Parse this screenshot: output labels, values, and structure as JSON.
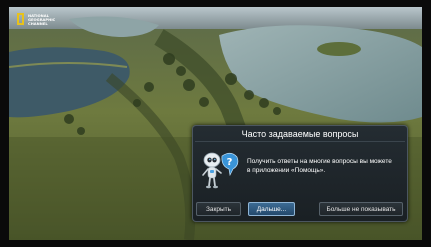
{
  "channel_logo": {
    "lines": [
      "NATIONAL",
      "GEOGRAPHIC",
      "CHANNEL"
    ],
    "frame_color": "#e8c21b"
  },
  "dialog": {
    "title": "Часто задаваемые вопросы",
    "message_line1": "Получить ответы на многие вопросы вы можете",
    "message_line2": "в приложении «Помощь».",
    "icon": "robot-help-icon",
    "buttons": {
      "close": "Закрыть",
      "next": "Дальше...",
      "never": "Больше не показывать"
    }
  }
}
